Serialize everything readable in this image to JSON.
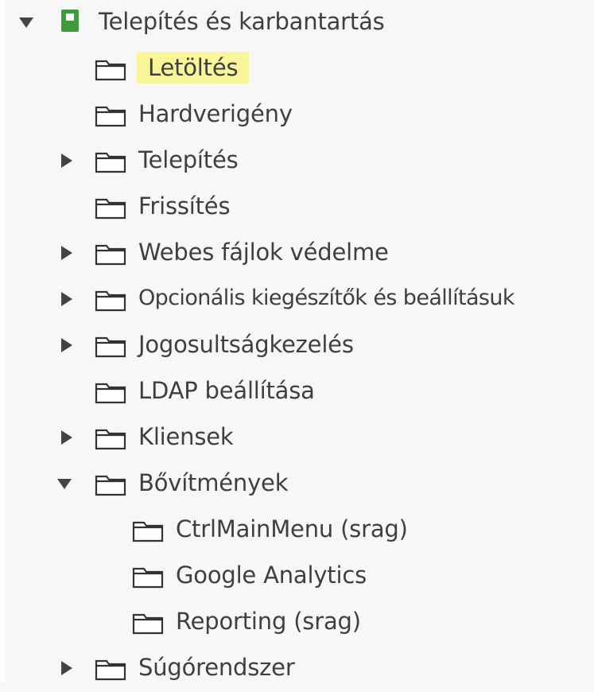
{
  "tree": {
    "root": {
      "label": "Telepítés és karbantartás",
      "expanded": true,
      "icon": "book-icon"
    },
    "items": [
      {
        "label": "Letöltés",
        "highlighted": true,
        "has_toggle": false,
        "expanded": false
      },
      {
        "label": "Hardverigény",
        "has_toggle": false,
        "expanded": false
      },
      {
        "label": "Telepítés",
        "has_toggle": true,
        "expanded": false
      },
      {
        "label": "Frissítés",
        "has_toggle": false,
        "expanded": false
      },
      {
        "label": "Webes fájlok védelme",
        "has_toggle": true,
        "expanded": false
      },
      {
        "label": "Opcionális kiegészítők és beállításuk",
        "has_toggle": true,
        "expanded": false
      },
      {
        "label": "Jogosultságkezelés",
        "has_toggle": true,
        "expanded": false
      },
      {
        "label": "LDAP beállítása",
        "has_toggle": false,
        "expanded": false
      },
      {
        "label": "Kliensek",
        "has_toggle": true,
        "expanded": false
      },
      {
        "label": "Bővítmények",
        "has_toggle": true,
        "expanded": true,
        "children": [
          {
            "label": "CtrlMainMenu (srag)"
          },
          {
            "label": "Google Analytics"
          },
          {
            "label": "Reporting (srag)"
          }
        ]
      },
      {
        "label": "Súgórendszer",
        "has_toggle": true,
        "expanded": false
      }
    ]
  },
  "colors": {
    "background": "#f7f7f7",
    "text": "#3f3f3f",
    "highlight": "#fbf59a",
    "book_green": "#3d9a3d",
    "toggle": "#444444"
  }
}
